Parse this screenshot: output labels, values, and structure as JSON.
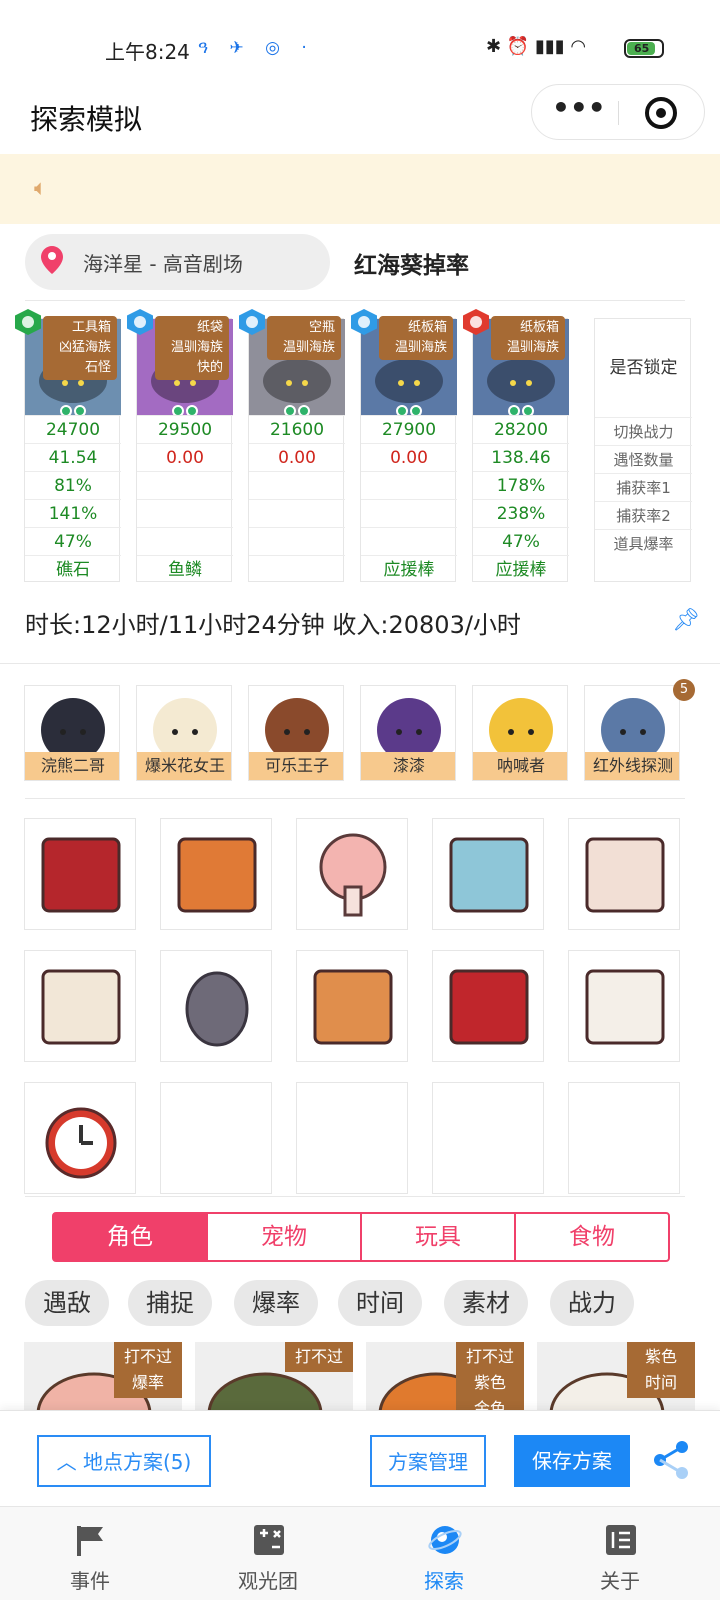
{
  "status_bar": {
    "time": "上午8:24",
    "battery": "65"
  },
  "nav": {
    "title": "探索模拟"
  },
  "location": {
    "name": "海洋星 - 高音剧场",
    "drop_title": "红海葵掉率"
  },
  "pets": [
    {
      "tag": [
        "工具箱",
        "凶猛海族",
        "石怪"
      ],
      "gem_color": "#27a84a",
      "power": "24700",
      "encounter": "41.54",
      "enc_color": "green",
      "capture1": "81%",
      "capture2": "141%",
      "drop": "47%",
      "item": "礁石",
      "bg": "#6d8fb0"
    },
    {
      "tag": [
        "纸袋",
        "温驯海族",
        "快的"
      ],
      "gem_color": "#2f9be6",
      "power": "29500",
      "encounter": "0.00",
      "enc_color": "red",
      "capture1": "",
      "capture2": "",
      "drop": "",
      "item": "鱼鳞",
      "bg": "#a36bc2"
    },
    {
      "tag": [
        "空瓶",
        "温驯海族"
      ],
      "gem_color": "#2f9be6",
      "power": "21600",
      "encounter": "0.00",
      "enc_color": "red",
      "capture1": "",
      "capture2": "",
      "drop": "",
      "item": "",
      "bg": "#8f8f9a"
    },
    {
      "tag": [
        "纸板箱",
        "温驯海族"
      ],
      "gem_color": "#2f9be6",
      "power": "27900",
      "encounter": "0.00",
      "enc_color": "red",
      "capture1": "",
      "capture2": "",
      "drop": "",
      "item": "应援棒",
      "bg": "#5b79a6"
    },
    {
      "tag": [
        "纸板箱",
        "温驯海族"
      ],
      "gem_color": "#e03a2e",
      "power": "28200",
      "encounter": "138.46",
      "enc_color": "green",
      "capture1": "178%",
      "capture2": "238%",
      "drop": "47%",
      "item": "应援棒",
      "bg": "#5b79a6"
    }
  ],
  "row_labels": {
    "header": "是否锁定",
    "labels": [
      "切换战力",
      "遇怪数量",
      "捕获率1",
      "捕获率2",
      "道具爆率"
    ]
  },
  "summary": "时长:12小时/11小时24分钟 收入:20803/小时",
  "characters": [
    {
      "name": "浣熊二哥"
    },
    {
      "name": "爆米花女王"
    },
    {
      "name": "可乐王子"
    },
    {
      "name": "漆漆"
    },
    {
      "name": "呐喊者"
    },
    {
      "name": "红外线探测",
      "badge": "5"
    }
  ],
  "items": [
    {
      "icon": "snack-bag-icon",
      "color": "#b5262c"
    },
    {
      "icon": "cork-board-icon",
      "color": "#e07a36"
    },
    {
      "icon": "mushroom-icon",
      "color": "#f3b4b0"
    },
    {
      "icon": "blanket-icon",
      "color": "#8ec6d8"
    },
    {
      "icon": "letter-icon",
      "color": "#f2dfd5"
    },
    {
      "icon": "clapperboard-icon",
      "color": "#f2e7d7"
    },
    {
      "icon": "rock-icon",
      "color": "#6e6a78"
    },
    {
      "icon": "cardboard-box-icon",
      "color": "#e08e4c"
    },
    {
      "icon": "food-box-icon",
      "color": "#c0262c"
    },
    {
      "icon": "envelope-icon",
      "color": "#f4efe8"
    },
    {
      "icon": "alarm-clock-icon",
      "color": "#d63a2c"
    },
    {
      "icon": "",
      "color": ""
    },
    {
      "icon": "",
      "color": ""
    },
    {
      "icon": "",
      "color": ""
    },
    {
      "icon": "",
      "color": ""
    }
  ],
  "category_tabs": [
    "角色",
    "宠物",
    "玩具",
    "食物"
  ],
  "filter_chips": [
    "遇敌",
    "捕捉",
    "爆率",
    "时间",
    "素材",
    "战力"
  ],
  "result_cards": [
    {
      "tag": [
        "打不过",
        "爆率"
      ],
      "color": "#f0b3a6"
    },
    {
      "tag": [
        "打不过"
      ],
      "color": "#5a6a3c"
    },
    {
      "tag": [
        "打不过",
        "紫色",
        "金色"
      ],
      "color": "#e07a2e"
    },
    {
      "tag": [
        "紫色",
        "时间"
      ],
      "color": "#f3efe8"
    }
  ],
  "actions": {
    "location_plan": "地点方案(5)",
    "manage": "方案管理",
    "save": "保存方案"
  },
  "tabbar": [
    {
      "label": "事件",
      "icon": "flag-icon"
    },
    {
      "label": "观光团",
      "icon": "calculator-icon"
    },
    {
      "label": "探索",
      "icon": "planet-icon",
      "active": true
    },
    {
      "label": "关于",
      "icon": "list-icon"
    }
  ],
  "colors": {
    "accent": "#f0406a",
    "primary": "#1c88f5",
    "tag": "#a66a34",
    "green": "#1d8a24",
    "red": "#d0261d"
  }
}
